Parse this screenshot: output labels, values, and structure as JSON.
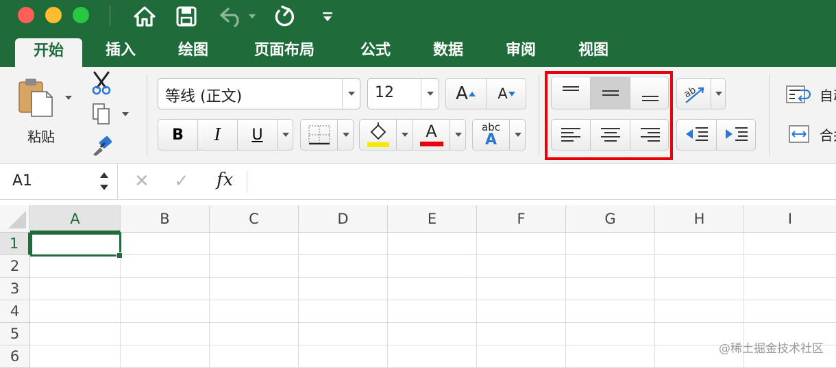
{
  "quick_access": {
    "icons": [
      "home-icon",
      "save-icon",
      "undo-icon",
      "redo-icon",
      "customize-icon"
    ]
  },
  "tabs": [
    "开始",
    "插入",
    "绘图",
    "页面布局",
    "公式",
    "数据",
    "审阅",
    "视图"
  ],
  "ribbon": {
    "paste_label": "粘贴",
    "font_name": "等线 (正文)",
    "font_size": "12",
    "grow_font": "A",
    "shrink_font": "A",
    "bold": "B",
    "italic": "I",
    "underline": "U",
    "font_color_letter": "A",
    "text_effects_top": "abc",
    "text_effects_bottom": "A",
    "wrap_text_label": "自动换行",
    "merge_label": "合并后居中",
    "colors": {
      "highlight": "#f6ea00",
      "font_color": "#e8000b",
      "accent_blue": "#2a78d4"
    }
  },
  "formula_bar": {
    "name_box": "A1",
    "cancel": "✕",
    "enter": "✓",
    "fx": "fx"
  },
  "sheet": {
    "columns": [
      "A",
      "B",
      "C",
      "D",
      "E",
      "F",
      "G",
      "H",
      "I"
    ],
    "rows": [
      "1",
      "2",
      "3",
      "4",
      "5",
      "6"
    ],
    "selected_cell": "A1"
  },
  "watermark": "@稀土掘金技术社区"
}
